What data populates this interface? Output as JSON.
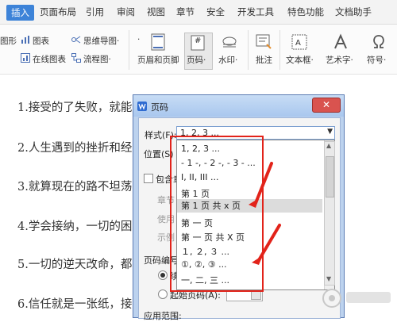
{
  "ribbon": {
    "tabs": [
      "插入",
      "页面布局",
      "引用",
      "审阅",
      "视图",
      "章节",
      "安全",
      "开发工具",
      "特色功能",
      "文档助手"
    ],
    "active_tab": "插入",
    "row1": {
      "shapes": "图形",
      "icons": "图表",
      "mindmap": "思维导图·",
      "dot": "·"
    },
    "row2": {
      "online_chart": "在线图表",
      "flowchart": "流程图·"
    },
    "buttons": {
      "header_footer": "页眉和页脚",
      "page_number": "页码·",
      "watermark": "水印·",
      "comment": "批注",
      "textbox": "文本框·",
      "wordart": "艺术字·",
      "symbol": "符号·"
    },
    "page_number_glyph": "#"
  },
  "document": {
    "lines": [
      "1.接受的了失败，就能",
      "2.人生遇到的挫折和经",
      "3.就算现在的路不坦荡",
      "4.学会接纳，一切的困",
      "5.一切的逆天改命，都",
      "6.信任就是一张纸，接"
    ]
  },
  "dialog": {
    "title": "页码",
    "close": "✕",
    "style_label": "样式(F):",
    "style_value": "1, 2, 3 ...",
    "position_label": "位置(S)",
    "include_label": "包含章",
    "chapter_label": "章节",
    "use_label": "使用",
    "example_label": "示例",
    "numbering_label": "页码编号",
    "restart_fragment": "续",
    "start_label": "起始页码(A):",
    "apply_label": "应用范围:",
    "options": [
      "1, 2, 3 ...",
      "- 1 -, - 2 -, - 3 - ...",
      "I, II, III ...",
      "第 1 页",
      "第 1 页 共 x 页",
      "第 一 页",
      "第 一 页 共 X 页",
      "１, ２, ３ ...",
      "①, ②, ③ ...",
      "一, 二, 三 ..."
    ],
    "selected_option": "第 1 页 共 x 页"
  },
  "colors": {
    "accent": "#3d83d8",
    "annotation": "#e2231a",
    "dialog_frame": "#bcd2ee"
  }
}
